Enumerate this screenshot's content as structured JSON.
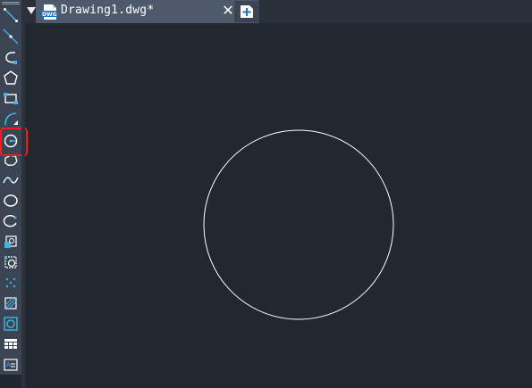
{
  "document_tab": {
    "title": "Drawing1.dwg*",
    "file_badge": "DWG",
    "close_glyph": "✕"
  },
  "toolbar": {
    "tools": [
      {
        "name": "line-tool",
        "icon": "line-icon"
      },
      {
        "name": "construction-line-tool",
        "icon": "xline-icon"
      },
      {
        "name": "polyline-tool",
        "icon": "polyline-icon"
      },
      {
        "name": "polygon-tool",
        "icon": "polygon-icon"
      },
      {
        "name": "rectangle-tool",
        "icon": "rectangle-icon"
      },
      {
        "name": "arc-tool",
        "icon": "arc-icon"
      },
      {
        "name": "circle-tool",
        "icon": "circle-icon",
        "highlighted": true
      },
      {
        "name": "revision-cloud-tool",
        "icon": "cloud-icon"
      },
      {
        "name": "spline-tool",
        "icon": "spline-icon"
      },
      {
        "name": "ellipse-tool",
        "icon": "ellipse-icon"
      },
      {
        "name": "ellipse-arc-tool",
        "icon": "ellipse-arc-icon"
      },
      {
        "name": "insert-block-tool",
        "icon": "insert-block-icon"
      },
      {
        "name": "make-block-tool",
        "icon": "make-block-icon"
      },
      {
        "name": "point-tool",
        "icon": "point-icon"
      },
      {
        "name": "hatch-tool",
        "icon": "hatch-icon"
      },
      {
        "name": "region-tool",
        "icon": "region-icon"
      },
      {
        "name": "table-tool",
        "icon": "table-icon"
      },
      {
        "name": "mtext-tool",
        "icon": "mtext-icon"
      }
    ]
  },
  "colors": {
    "canvas_background": "#212830",
    "toolbar_background": "#3b4453",
    "active_tab": "#4d5a6c",
    "drawn_entity": "#ffffff",
    "highlight": "#ff1a1a",
    "icon_accent": "#3fb6e8"
  }
}
